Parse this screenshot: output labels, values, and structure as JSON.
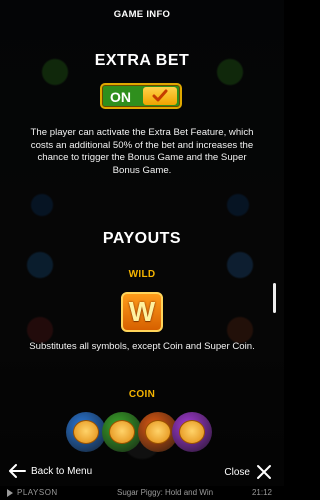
{
  "header": {
    "title": "GAME INFO"
  },
  "extra_bet": {
    "title": "EXTRA BET",
    "toggle_label": "ON",
    "toggle_state": "on",
    "description": "The player can activate the Extra Bet Feature, which costs an additional 50% of the bet and increases the chance to trigger the Bonus Game and the Super Bonus Game."
  },
  "payouts": {
    "title": "PAYOUTS",
    "wild": {
      "title": "WILD",
      "symbol_letter": "W",
      "description": "Substitutes all symbols, except Coin and Super Coin."
    },
    "coin": {
      "title": "COIN",
      "coins": [
        {
          "color": "#2a78d8"
        },
        {
          "color": "#3aa62a"
        },
        {
          "color": "#e05a12"
        },
        {
          "color": "#a43ad6"
        }
      ]
    }
  },
  "nav": {
    "back_label": "Back to Menu",
    "close_label": "Close"
  },
  "footer": {
    "brand": "PLAYSON",
    "game_name": "Sugar Piggy: Hold and Win",
    "time": "21:12"
  },
  "colors": {
    "accent_gold": "#f5b400",
    "toggle_green": "#2f8f1d"
  }
}
